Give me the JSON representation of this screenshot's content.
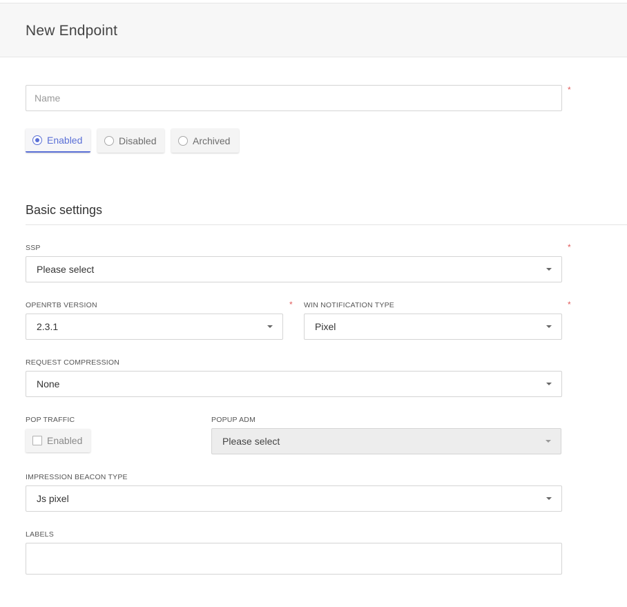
{
  "header": {
    "title": "New Endpoint"
  },
  "name_field": {
    "placeholder": "Name",
    "value": "",
    "required_mark": "*"
  },
  "status": {
    "options": [
      {
        "label": "Enabled",
        "selected": true
      },
      {
        "label": "Disabled",
        "selected": false
      },
      {
        "label": "Archived",
        "selected": false
      }
    ]
  },
  "basic_settings": {
    "title": "Basic settings",
    "ssp": {
      "label": "SSP",
      "value": "Please select",
      "required_mark": "*"
    },
    "openrtb_version": {
      "label": "OPENRTB VERSION",
      "value": "2.3.1",
      "required_mark": "*"
    },
    "win_notification_type": {
      "label": "WIN NOTIFICATION TYPE",
      "value": "Pixel",
      "required_mark": "*"
    },
    "request_compression": {
      "label": "REQUEST COMPRESSION",
      "value": "None"
    },
    "pop_traffic": {
      "label": "POP TRAFFIC",
      "checkbox_label": "Enabled",
      "checked": false
    },
    "popup_adm": {
      "label": "POPUP ADM",
      "value": "Please select",
      "disabled": true
    },
    "impression_beacon_type": {
      "label": "IMPRESSION BEACON TYPE",
      "value": "Js pixel"
    },
    "labels": {
      "label": "LABELS",
      "value": ""
    }
  },
  "colors": {
    "accent": "#5a6fd6",
    "required": "#e05a5a",
    "header_bg": "#f7f7f7",
    "disabled_bg": "#ededed"
  },
  "icons": {
    "dropdown": "caret-down-icon",
    "radio": "radio-icon",
    "checkbox": "checkbox-icon"
  }
}
